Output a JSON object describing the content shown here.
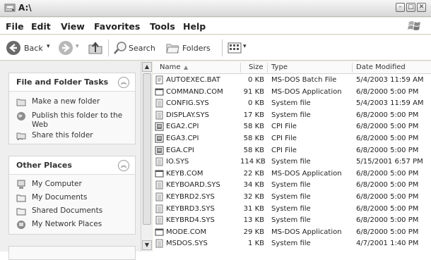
{
  "window": {
    "title": "A:\\"
  },
  "menu": [
    "File",
    "Edit",
    "View",
    "Favorites",
    "Tools",
    "Help"
  ],
  "toolbar": {
    "back_label": "Back",
    "search_label": "Search",
    "folders_label": "Folders"
  },
  "tasks": {
    "file_folder": {
      "heading": "File and Folder Tasks",
      "links": [
        "Make a new folder",
        "Publish this folder to the Web",
        "Share this folder"
      ]
    },
    "other_places": {
      "heading": "Other Places",
      "links": [
        "My Computer",
        "My Documents",
        "Shared Documents",
        "My Network Places"
      ]
    }
  },
  "columns": {
    "name": "Name",
    "size": "Size",
    "type": "Type",
    "date": "Date Modified"
  },
  "files": [
    {
      "name": "AUTOEXEC.BAT",
      "size": "0 KB",
      "type": "MS-DOS Batch File",
      "date": "5/4/2003 11:59 AM",
      "icon": "batch-file-icon"
    },
    {
      "name": "COMMAND.COM",
      "size": "91 KB",
      "type": "MS-DOS Application",
      "date": "6/8/2000 5:00 PM",
      "icon": "application-icon"
    },
    {
      "name": "CONFIG.SYS",
      "size": "0 KB",
      "type": "System file",
      "date": "5/4/2003 11:59 AM",
      "icon": "system-file-icon"
    },
    {
      "name": "DISPLAY.SYS",
      "size": "17 KB",
      "type": "System file",
      "date": "6/8/2000 5:00 PM",
      "icon": "system-file-icon"
    },
    {
      "name": "EGA2.CPI",
      "size": "58 KB",
      "type": "CPI File",
      "date": "6/8/2000 5:00 PM",
      "icon": "cpi-file-icon"
    },
    {
      "name": "EGA3.CPI",
      "size": "58 KB",
      "type": "CPI File",
      "date": "6/8/2000 5:00 PM",
      "icon": "cpi-file-icon"
    },
    {
      "name": "EGA.CPI",
      "size": "58 KB",
      "type": "CPI File",
      "date": "6/8/2000 5:00 PM",
      "icon": "cpi-file-icon"
    },
    {
      "name": "IO.SYS",
      "size": "114 KB",
      "type": "System file",
      "date": "5/15/2001 6:57 PM",
      "icon": "system-file-icon"
    },
    {
      "name": "KEYB.COM",
      "size": "22 KB",
      "type": "MS-DOS Application",
      "date": "6/8/2000 5:00 PM",
      "icon": "application-icon"
    },
    {
      "name": "KEYBOARD.SYS",
      "size": "34 KB",
      "type": "System file",
      "date": "6/8/2000 5:00 PM",
      "icon": "system-file-icon"
    },
    {
      "name": "KEYBRD2.SYS",
      "size": "32 KB",
      "type": "System file",
      "date": "6/8/2000 5:00 PM",
      "icon": "system-file-icon"
    },
    {
      "name": "KEYBRD3.SYS",
      "size": "31 KB",
      "type": "System file",
      "date": "6/8/2000 5:00 PM",
      "icon": "system-file-icon"
    },
    {
      "name": "KEYBRD4.SYS",
      "size": "13 KB",
      "type": "System file",
      "date": "6/8/2000 5:00 PM",
      "icon": "system-file-icon"
    },
    {
      "name": "MODE.COM",
      "size": "29 KB",
      "type": "MS-DOS Application",
      "date": "6/8/2000 5:00 PM",
      "icon": "application-icon"
    },
    {
      "name": "MSDOS.SYS",
      "size": "1 KB",
      "type": "System file",
      "date": "4/7/2001 1:40 PM",
      "icon": "system-file-icon"
    }
  ]
}
